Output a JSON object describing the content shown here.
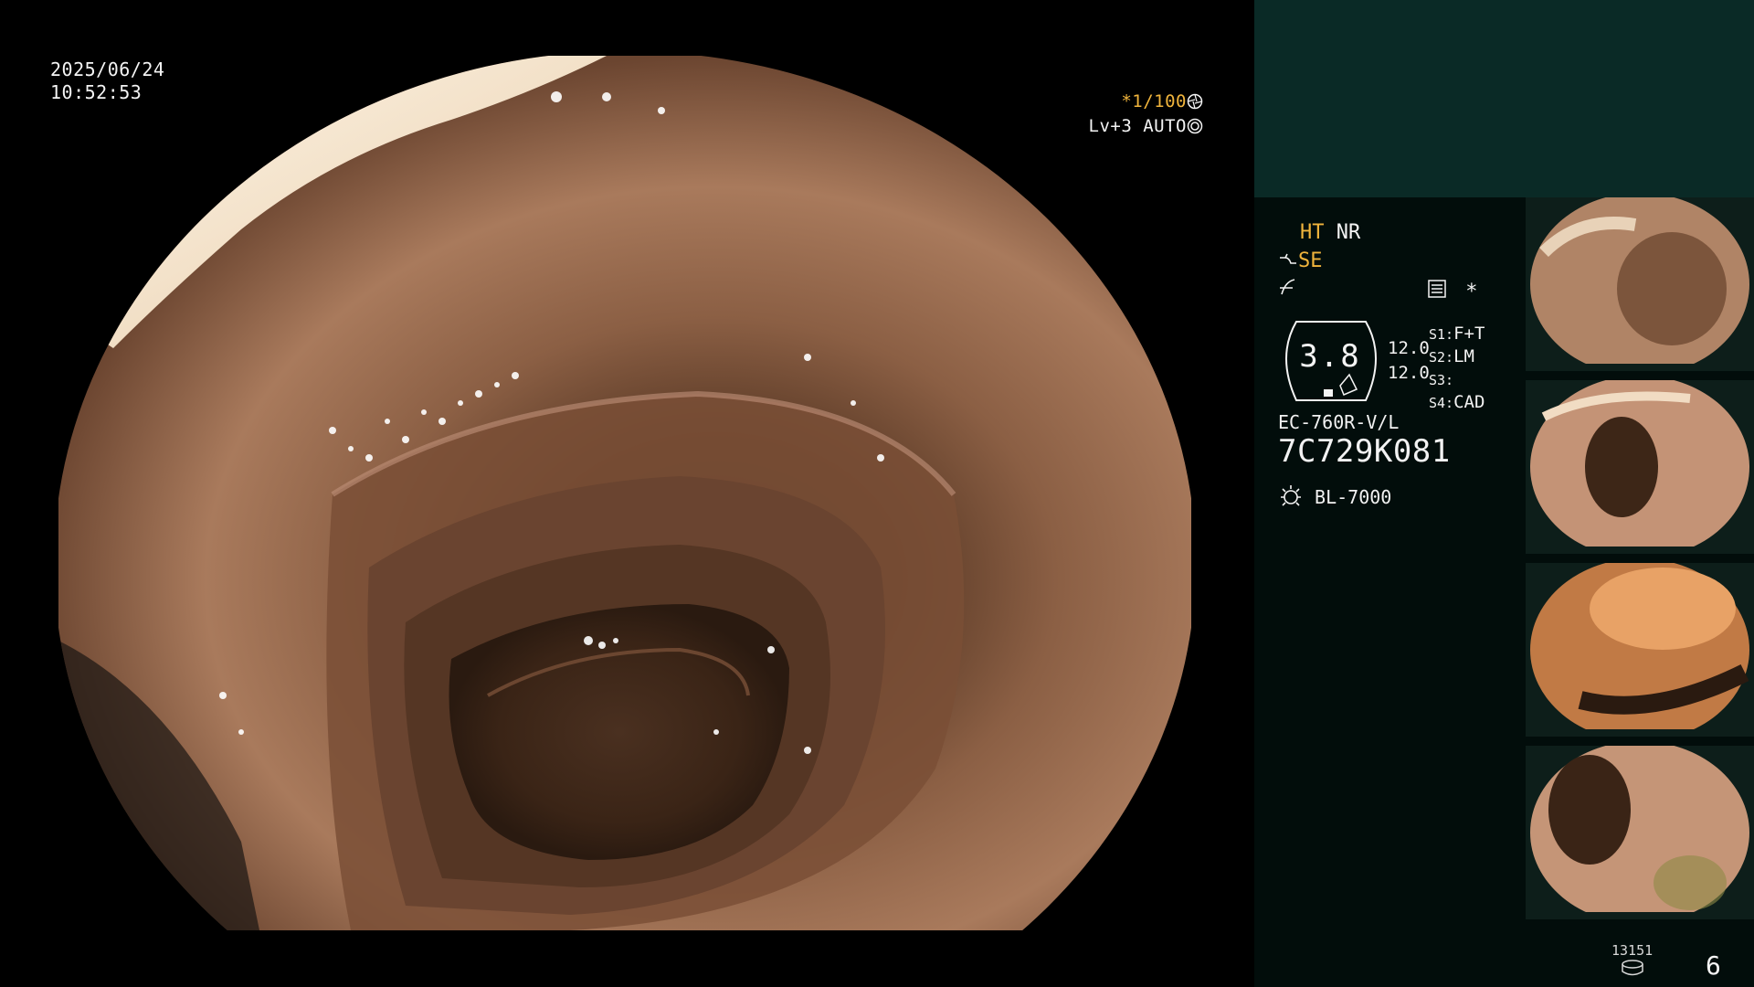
{
  "osd": {
    "date": "2025/06/24",
    "time": "10:52:53",
    "shutter": "*1/100",
    "level": "Lv+3",
    "iris_mode": "AUTO"
  },
  "panel": {
    "ht": "HT",
    "nr": "NR",
    "se": "SE",
    "gauge_value": "3.8",
    "val_1": "12.0",
    "val_2": "12.0",
    "s1_label": "S1:",
    "s1_value": "F+T",
    "s2_label": "S2:",
    "s2_value": "LM",
    "s3_label": "S3:",
    "s3_value": "",
    "s4_label": "S4:",
    "s4_value": "CAD",
    "asterisk": "*",
    "scope_model": "EC-760R-V/L",
    "scope_serial": "7C729K081",
    "light_source": "BL-7000"
  },
  "storage": {
    "capacity": "13151",
    "captured_count": "6"
  },
  "icons": [
    "shutter-icon",
    "iris-icon",
    "enhance-icon",
    "curve-icon",
    "menu-list-icon",
    "light-source-icon",
    "database-icon"
  ],
  "colors": {
    "accent_yellow": "#f0b43c",
    "panel_teal": "#0a2a26",
    "panel_dark": "#020d0b"
  }
}
